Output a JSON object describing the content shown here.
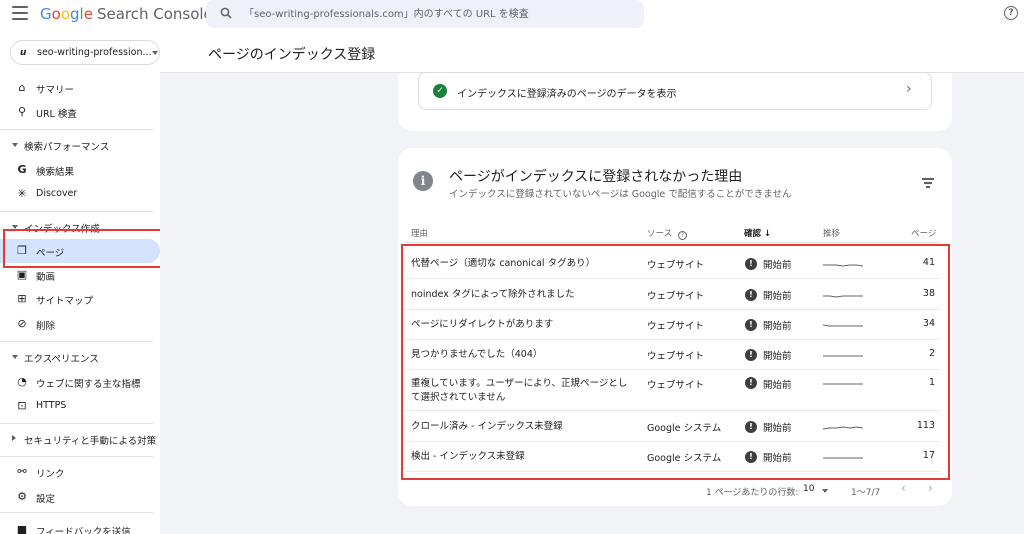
{
  "app": {
    "logo_letters": [
      "G",
      "o",
      "o",
      "g",
      "l",
      "e"
    ],
    "logo_suffix": "Search Console",
    "search_placeholder": "「seo-writing-professionals.com」内のすべての URL を検査",
    "help_icon": "help-circle-icon"
  },
  "property": {
    "badge": "u",
    "name": "seo-writing-profession..."
  },
  "page": {
    "title": "ページのインデックス登録"
  },
  "sidebar": {
    "summary": "サマリー",
    "url_inspection": "URL 検査",
    "performance_section": "検索パフォーマンス",
    "search_results": "検索結果",
    "discover": "Discover",
    "indexing_section": "インデックス作成",
    "pages": "ページ",
    "videos": "動画",
    "sitemaps": "サイトマップ",
    "removals": "削除",
    "experience_section": "エクスペリエンス",
    "core_web_vitals": "ウェブに関する主な指標",
    "https": "HTTPS",
    "security_section": "セキュリティと手動による対策",
    "links": "リンク",
    "settings": "設定",
    "feedback": "フィードバックを送信"
  },
  "indexed_link": {
    "label": "インデックスに登録済みのページのデータを表示"
  },
  "reasons": {
    "title": "ページがインデックスに登録されなかった理由",
    "subtitle": "インデックスに登録されていないページは Google で配信することができません",
    "columns": {
      "reason": "理由",
      "source": "ソース",
      "validation": "確認",
      "trend": "推移",
      "pages": "ページ"
    },
    "rows": [
      {
        "reason": "代替ページ（適切な canonical タグあり）",
        "source": "ウェブサイト",
        "status": "開始前",
        "pages": "41",
        "trend": [
          3,
          3,
          3,
          2,
          3,
          3,
          2
        ]
      },
      {
        "reason": "noindex タグによって除外されました",
        "source": "ウェブサイト",
        "status": "開始前",
        "pages": "38",
        "trend": [
          3,
          3,
          2,
          3,
          3,
          3,
          3
        ]
      },
      {
        "reason": "ページにリダイレクトがあります",
        "source": "ウェブサイト",
        "status": "開始前",
        "pages": "34",
        "trend": [
          4,
          3,
          3,
          3,
          3,
          3,
          3
        ]
      },
      {
        "reason": "見つかりませんでした（404）",
        "source": "ウェブサイト",
        "status": "開始前",
        "pages": "2",
        "trend": [
          3,
          3,
          3,
          3,
          3,
          3,
          3
        ]
      },
      {
        "reason": "重複しています。ユーザーにより、正規ページとして選択されていません",
        "source": "ウェブサイト",
        "status": "開始前",
        "pages": "1",
        "trend": [
          3,
          3,
          3,
          3,
          3,
          3,
          3
        ]
      },
      {
        "reason": "クロール済み - インデックス未登録",
        "source": "Google システム",
        "status": "開始前",
        "pages": "113",
        "trend": [
          2,
          3,
          3,
          4,
          3,
          4,
          3
        ]
      },
      {
        "reason": "検出 - インデックス未登録",
        "source": "Google システム",
        "status": "開始前",
        "pages": "17",
        "trend": [
          3,
          3,
          3,
          3,
          3,
          3,
          3
        ]
      }
    ]
  },
  "pagination": {
    "rows_label": "1 ページあたりの行数:",
    "rows_value": "10",
    "range": "1〜7/7",
    "prev": "‹",
    "next": "›"
  },
  "colors": {
    "accent_blue": "#1a73e8",
    "active_nav": "#d3e3fd",
    "highlight_red": "#e53935",
    "success_green": "#188038"
  }
}
